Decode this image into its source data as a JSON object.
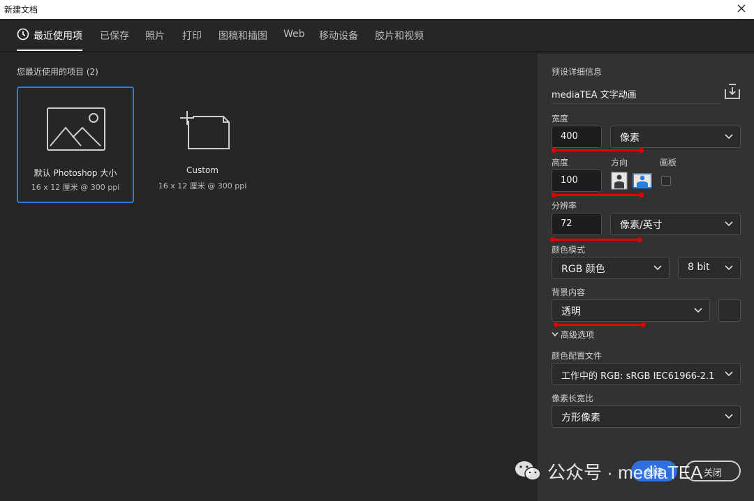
{
  "window": {
    "title": "新建文档"
  },
  "tabs": [
    {
      "label": "最近使用项",
      "active": true
    },
    {
      "label": "已保存"
    },
    {
      "label": "照片"
    },
    {
      "label": "打印"
    },
    {
      "label": "图稿和插图"
    },
    {
      "label": "Web"
    },
    {
      "label": "移动设备"
    },
    {
      "label": "胶片和视频"
    }
  ],
  "recent": {
    "heading": "您最近使用的项目 (2)",
    "items": [
      {
        "name": "默认 Photoshop 大小",
        "dims": "16 x 12 厘米 @ 300 ppi",
        "icon": "image-icon",
        "selected": true
      },
      {
        "name": "Custom",
        "dims": "16 x 12 厘米 @ 300 ppi",
        "icon": "custom-doc-icon",
        "selected": false
      }
    ]
  },
  "details": {
    "heading": "预设详细信息",
    "preset_name": "mediaTEA 文字动画",
    "width_label": "宽度",
    "width_value": "400",
    "width_unit": "像素",
    "height_label": "高度",
    "height_value": "100",
    "orientation_label": "方向",
    "artboard_label": "画板",
    "resolution_label": "分辨率",
    "resolution_value": "72",
    "resolution_unit": "像素/英寸",
    "color_mode_label": "颜色模式",
    "color_mode": "RGB 颜色",
    "bit_depth": "8 bit",
    "background_label": "背景内容",
    "background": "透明",
    "advanced_label": "高级选项",
    "color_profile_label": "颜色配置文件",
    "color_profile": "工作中的 RGB: sRGB IEC61966-2.1",
    "pixel_aspect_label": "像素长宽比",
    "pixel_aspect": "方形像素"
  },
  "buttons": {
    "create": "创建",
    "close": "关闭"
  },
  "watermark": {
    "text": "公众号 · mediaTEA"
  },
  "colors": {
    "accent": "#2b7de0",
    "annotation": "#e00000",
    "panel": "#323232",
    "background": "#262626"
  }
}
